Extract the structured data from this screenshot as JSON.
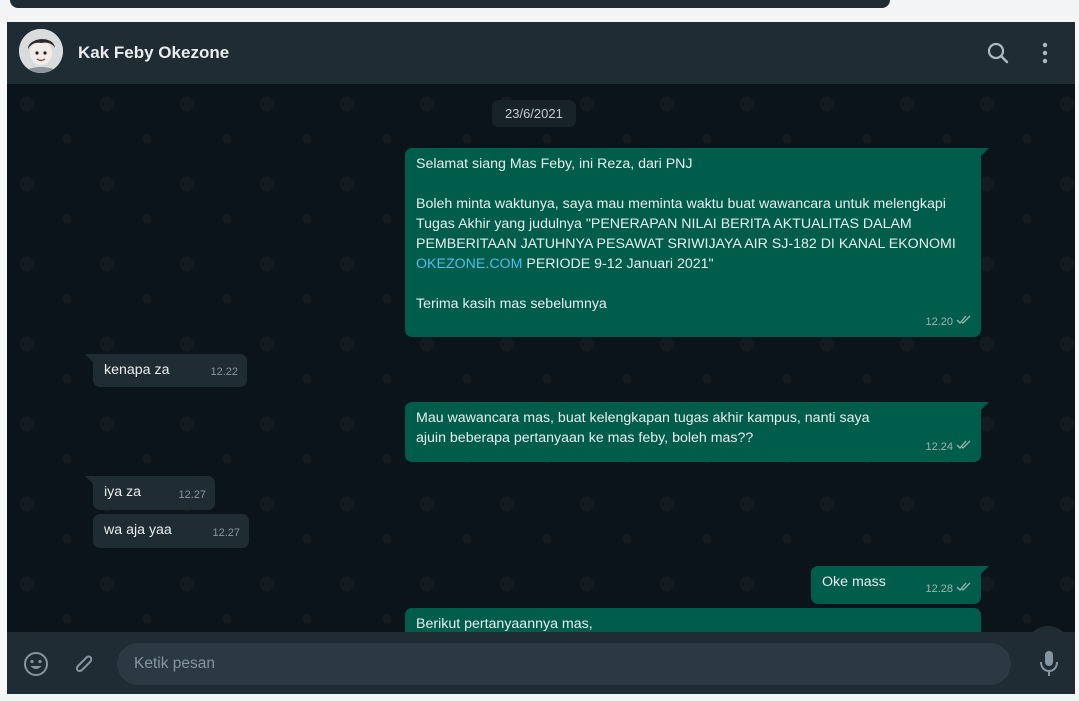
{
  "header": {
    "contact_name": "Kak Feby Okezone",
    "icons": [
      "search-icon",
      "menu-icon"
    ]
  },
  "chat": {
    "date": "23/6/2021",
    "m1": {
      "p1": "Selamat siang Mas Feby, ini Reza, dari PNJ",
      "p2a": "Boleh minta waktunya, saya mau meminta waktu buat wawancara untuk melengkapi  Tugas Akhir yang judulnya \"PENERAPAN NILAI BERITA AKTUALITAS DALAM PEMBERITAAN JATUHNYA PESAWAT SRIWIJAYA AIR SJ-182 DI KANAL EKONOMI ",
      "link": "OKEZONE.COM",
      "p2b": " PERIODE 9-12 Januari 2021\"",
      "p3": "Terima kasih mas sebelumnya",
      "time": "12.20"
    },
    "m2": {
      "text": "kenapa za",
      "time": "12.22"
    },
    "m3": {
      "text": "Mau wawancara mas, buat kelengkapan tugas akhir kampus, nanti saya ajuin beberapa pertanyaan ke mas feby, boleh mas??",
      "time": "12.24"
    },
    "m4": {
      "text": "iya za",
      "time": "12.27"
    },
    "m5": {
      "text": "wa aja yaa",
      "time": "12.27"
    },
    "m6": {
      "text": "Oke mass",
      "time": "12.28"
    },
    "m7": {
      "text": "Berikut pertanyaannya mas,"
    }
  },
  "composer": {
    "placeholder": "Ketik pesan",
    "icons": [
      "emoji-icon",
      "attach-icon",
      "microphone-icon"
    ]
  },
  "colors": {
    "chat_background": "#0b141a",
    "header": "#202c33",
    "outgoing_bubble": "#005c4b",
    "incoming_bubble": "#202c33",
    "link": "#53bdeb"
  }
}
